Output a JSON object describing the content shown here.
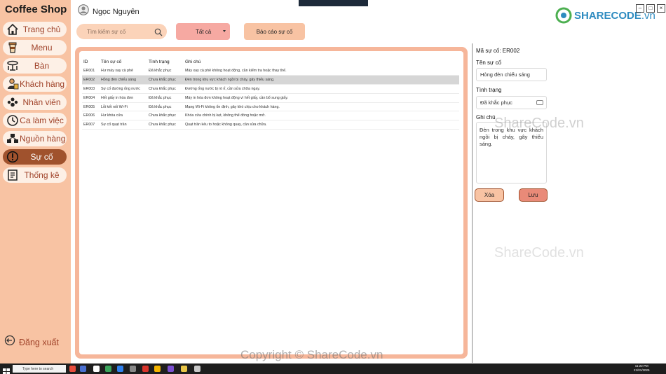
{
  "app": {
    "title": "Coffee Shop"
  },
  "user": {
    "name": "Ngọc Nguyên"
  },
  "sidebar": {
    "items": [
      {
        "label": "Trang chủ",
        "icon": "home-icon"
      },
      {
        "label": "Menu",
        "icon": "cup-icon"
      },
      {
        "label": "Bàn",
        "icon": "table-icon"
      },
      {
        "label": "Khách hàng",
        "icon": "customer-icon"
      },
      {
        "label": "Nhân viên",
        "icon": "staff-icon"
      },
      {
        "label": "Ca làm việc",
        "icon": "clock-icon"
      },
      {
        "label": "Nguồn hàng",
        "icon": "supply-icon"
      },
      {
        "label": "Sự cố",
        "icon": "alert-icon",
        "active": true
      },
      {
        "label": "Thống kê",
        "icon": "report-icon"
      }
    ],
    "logout_label": "Đăng xuất"
  },
  "toolbar": {
    "search_placeholder": "Tìm kiếm sự cố",
    "filter_value": "Tất cả",
    "report_label": "Báo cáo sự cố"
  },
  "table": {
    "headers": [
      "ID",
      "Tên sự cố",
      "Tình trạng",
      "Ghi chú"
    ],
    "rows": [
      [
        "ER001",
        "Hư máy xay cà phê",
        "Đã khắc phục",
        "Máy xay cà phê không hoạt động, cần kiểm tra hoặc thay thế."
      ],
      [
        "ER002",
        "Hỏng đèn chiếu sáng",
        "Chưa khắc phục",
        "Đèn trong khu vực khách ngồi bị cháy, gây thiếu sáng."
      ],
      [
        "ER003",
        "Sự cố đường ống nước",
        "Chưa khắc phục",
        "Đường ống nước bị rò rỉ, cần sửa chữa ngay."
      ],
      [
        "ER004",
        "Hết giấy in hóa đơn",
        "Đã khắc phục",
        "Máy in hóa đơn không hoạt động vì hết giấy, cần bổ sung giấy."
      ],
      [
        "ER005",
        "Lỗi kết nối Wi-Fi",
        "Đã khắc phục",
        "Mạng Wi-Fi không ổn định, gây khó chịu cho khách hàng."
      ],
      [
        "ER006",
        "Hư khóa cửa",
        "Chưa khắc phục",
        "Khóa cửa chính bị kẹt, không thể đóng hoặc mở."
      ],
      [
        "ER007",
        "Sự cố quạt trần",
        "Chưa khắc phục",
        "Quạt trần kêu to hoặc không quay, cần sửa chữa."
      ]
    ],
    "selected_index": 1
  },
  "detail": {
    "id_label": "Mã sự cố: ER002",
    "name_label": "Tên sự cố",
    "name_value": "Hỏng đèn chiếu sáng",
    "status_label": "Tình trạng",
    "status_value": "Đã khắc phục",
    "note_label": "Ghi chú",
    "note_value": "Đèn trong khu vực khách ngồi bị cháy, gây thiếu sáng.",
    "delete_label": "Xóa",
    "save_label": "Lưu"
  },
  "brand": {
    "part1": "SHARECODE",
    "part2": ".vn"
  },
  "watermark": {
    "text": "ShareCode.vn",
    "copyright": "Copyright © ShareCode.vn"
  },
  "taskbar": {
    "search_text": "Type here to search",
    "time": "11:22 PM",
    "date": "21/01/2025"
  },
  "colors": {
    "sidebar_bg": "#f8c3a3",
    "active_item": "#a0522d",
    "accent": "#e98a78"
  }
}
